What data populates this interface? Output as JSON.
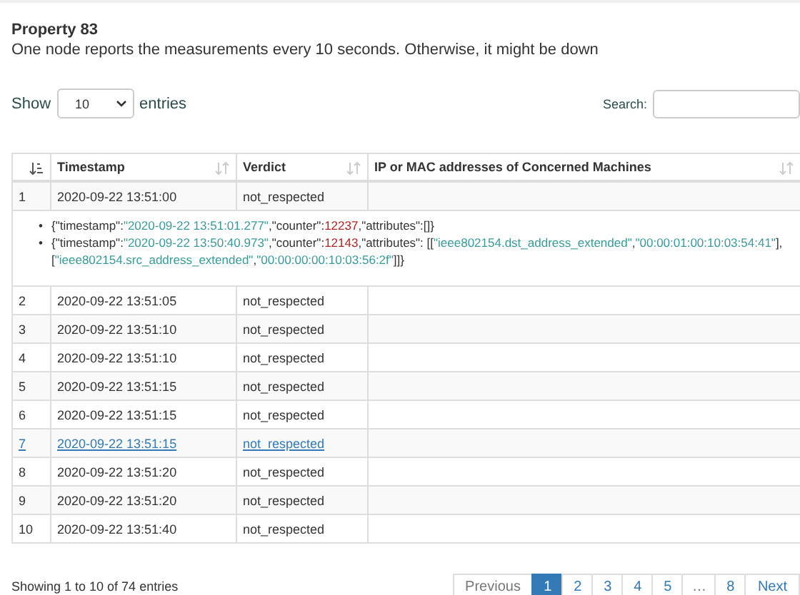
{
  "title": "Property 83",
  "description": "One node reports the measurements every 10 seconds. Otherwise, it might be down",
  "length_menu": {
    "before": "Show",
    "value": "10",
    "after": "entries"
  },
  "search": {
    "label": "Search:"
  },
  "table": {
    "columns": [
      {
        "sorted": true
      },
      {
        "label": "Timestamp",
        "sorted": false
      },
      {
        "label": "Verdict",
        "sorted": false
      },
      {
        "label": "IP or MAC addresses of  Concerned Machines",
        "sorted": false
      }
    ],
    "rows": [
      {
        "cells": [
          "1",
          "2020-09-22 13:51:00",
          "not_respected",
          ""
        ],
        "hovered": false,
        "details": [
          {
            "bullet": "•",
            "tokens": [
              {
                "kind": "punct",
                "text": "{"
              },
              {
                "kind": "key",
                "text": "\"timestamp\":"
              },
              {
                "kind": "string",
                "text": "\"2020-09-22 13:51:01.277\""
              },
              {
                "kind": "key",
                "text": ",\"counter\":"
              },
              {
                "kind": "number",
                "text": "12237"
              },
              {
                "kind": "key",
                "text": ",\"attributes\":[]}"
              }
            ]
          },
          {
            "bullet": "•",
            "tokens": [
              {
                "kind": "punct",
                "text": "{"
              },
              {
                "kind": "key",
                "text": "\"timestamp\":"
              },
              {
                "kind": "string",
                "text": "\"2020-09-22 13:50:40.973\""
              },
              {
                "kind": "key",
                "text": ",\"counter\":"
              },
              {
                "kind": "number",
                "text": "12143"
              },
              {
                "kind": "key",
                "text": ",\"attributes\": [["
              },
              {
                "kind": "string",
                "text": "\"ieee802154.dst_address_extended\""
              },
              {
                "kind": "punct",
                "text": ","
              },
              {
                "kind": "string",
                "text": "\"00:00:01:00:10:03:54:41\""
              },
              {
                "kind": "punct",
                "text": "],["
              },
              {
                "kind": "string",
                "text": "\"ieee802154.src_address_extended\""
              },
              {
                "kind": "punct",
                "text": ","
              },
              {
                "kind": "string",
                "text": "\"00:00:00:00:10:03:56:2f\""
              },
              {
                "kind": "punct",
                "text": "]]}"
              }
            ]
          }
        ]
      },
      {
        "cells": [
          "2",
          "2020-09-22 13:51:05",
          "not_respected",
          ""
        ],
        "hovered": false
      },
      {
        "cells": [
          "3",
          "2020-09-22 13:51:10",
          "not_respected",
          ""
        ],
        "hovered": false
      },
      {
        "cells": [
          "4",
          "2020-09-22 13:51:10",
          "not_respected",
          ""
        ],
        "hovered": false
      },
      {
        "cells": [
          "5",
          "2020-09-22 13:51:15",
          "not_respected",
          ""
        ],
        "hovered": false
      },
      {
        "cells": [
          "6",
          "2020-09-22 13:51:15",
          "not_respected",
          ""
        ],
        "hovered": false
      },
      {
        "cells": [
          "7",
          "2020-09-22 13:51:15",
          "not_respected",
          ""
        ],
        "hovered": true
      },
      {
        "cells": [
          "8",
          "2020-09-22 13:51:20",
          "not_respected",
          ""
        ],
        "hovered": false
      },
      {
        "cells": [
          "9",
          "2020-09-22 13:51:20",
          "not_respected",
          ""
        ],
        "hovered": false
      },
      {
        "cells": [
          "10",
          "2020-09-22 13:51:40",
          "not_respected",
          ""
        ],
        "hovered": false
      }
    ]
  },
  "info": "Showing 1 to 10 of 74 entries",
  "pagination": [
    {
      "label": "Previous",
      "kind": "nav",
      "selected": false
    },
    {
      "label": "1",
      "kind": "page",
      "selected": true
    },
    {
      "label": "2",
      "kind": "page",
      "selected": false
    },
    {
      "label": "3",
      "kind": "page",
      "selected": false
    },
    {
      "label": "4",
      "kind": "page",
      "selected": false
    },
    {
      "label": "5",
      "kind": "page",
      "selected": false
    },
    {
      "label": "…",
      "kind": "ellipsis",
      "selected": false
    },
    {
      "label": "8",
      "kind": "page",
      "selected": false
    },
    {
      "label": "Next",
      "kind": "nav",
      "selected": false
    }
  ]
}
